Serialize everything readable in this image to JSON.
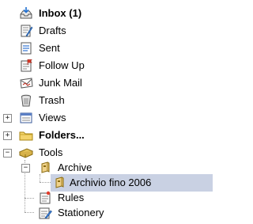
{
  "tree": {
    "inbox": "Inbox (1)",
    "drafts": "Drafts",
    "sent": "Sent",
    "follow_up": "Follow Up",
    "junk_mail": "Junk Mail",
    "trash": "Trash",
    "views": "Views",
    "folders": "Folders...",
    "tools": "Tools",
    "archive": "Archive",
    "archive_2006": "Archivio fino 2006",
    "rules": "Rules",
    "stationery": "Stationery"
  },
  "expanders": {
    "views": "+",
    "folders": "+",
    "tools": "−",
    "archive": "−"
  },
  "colors": {
    "selection": "#c9d1e3"
  }
}
